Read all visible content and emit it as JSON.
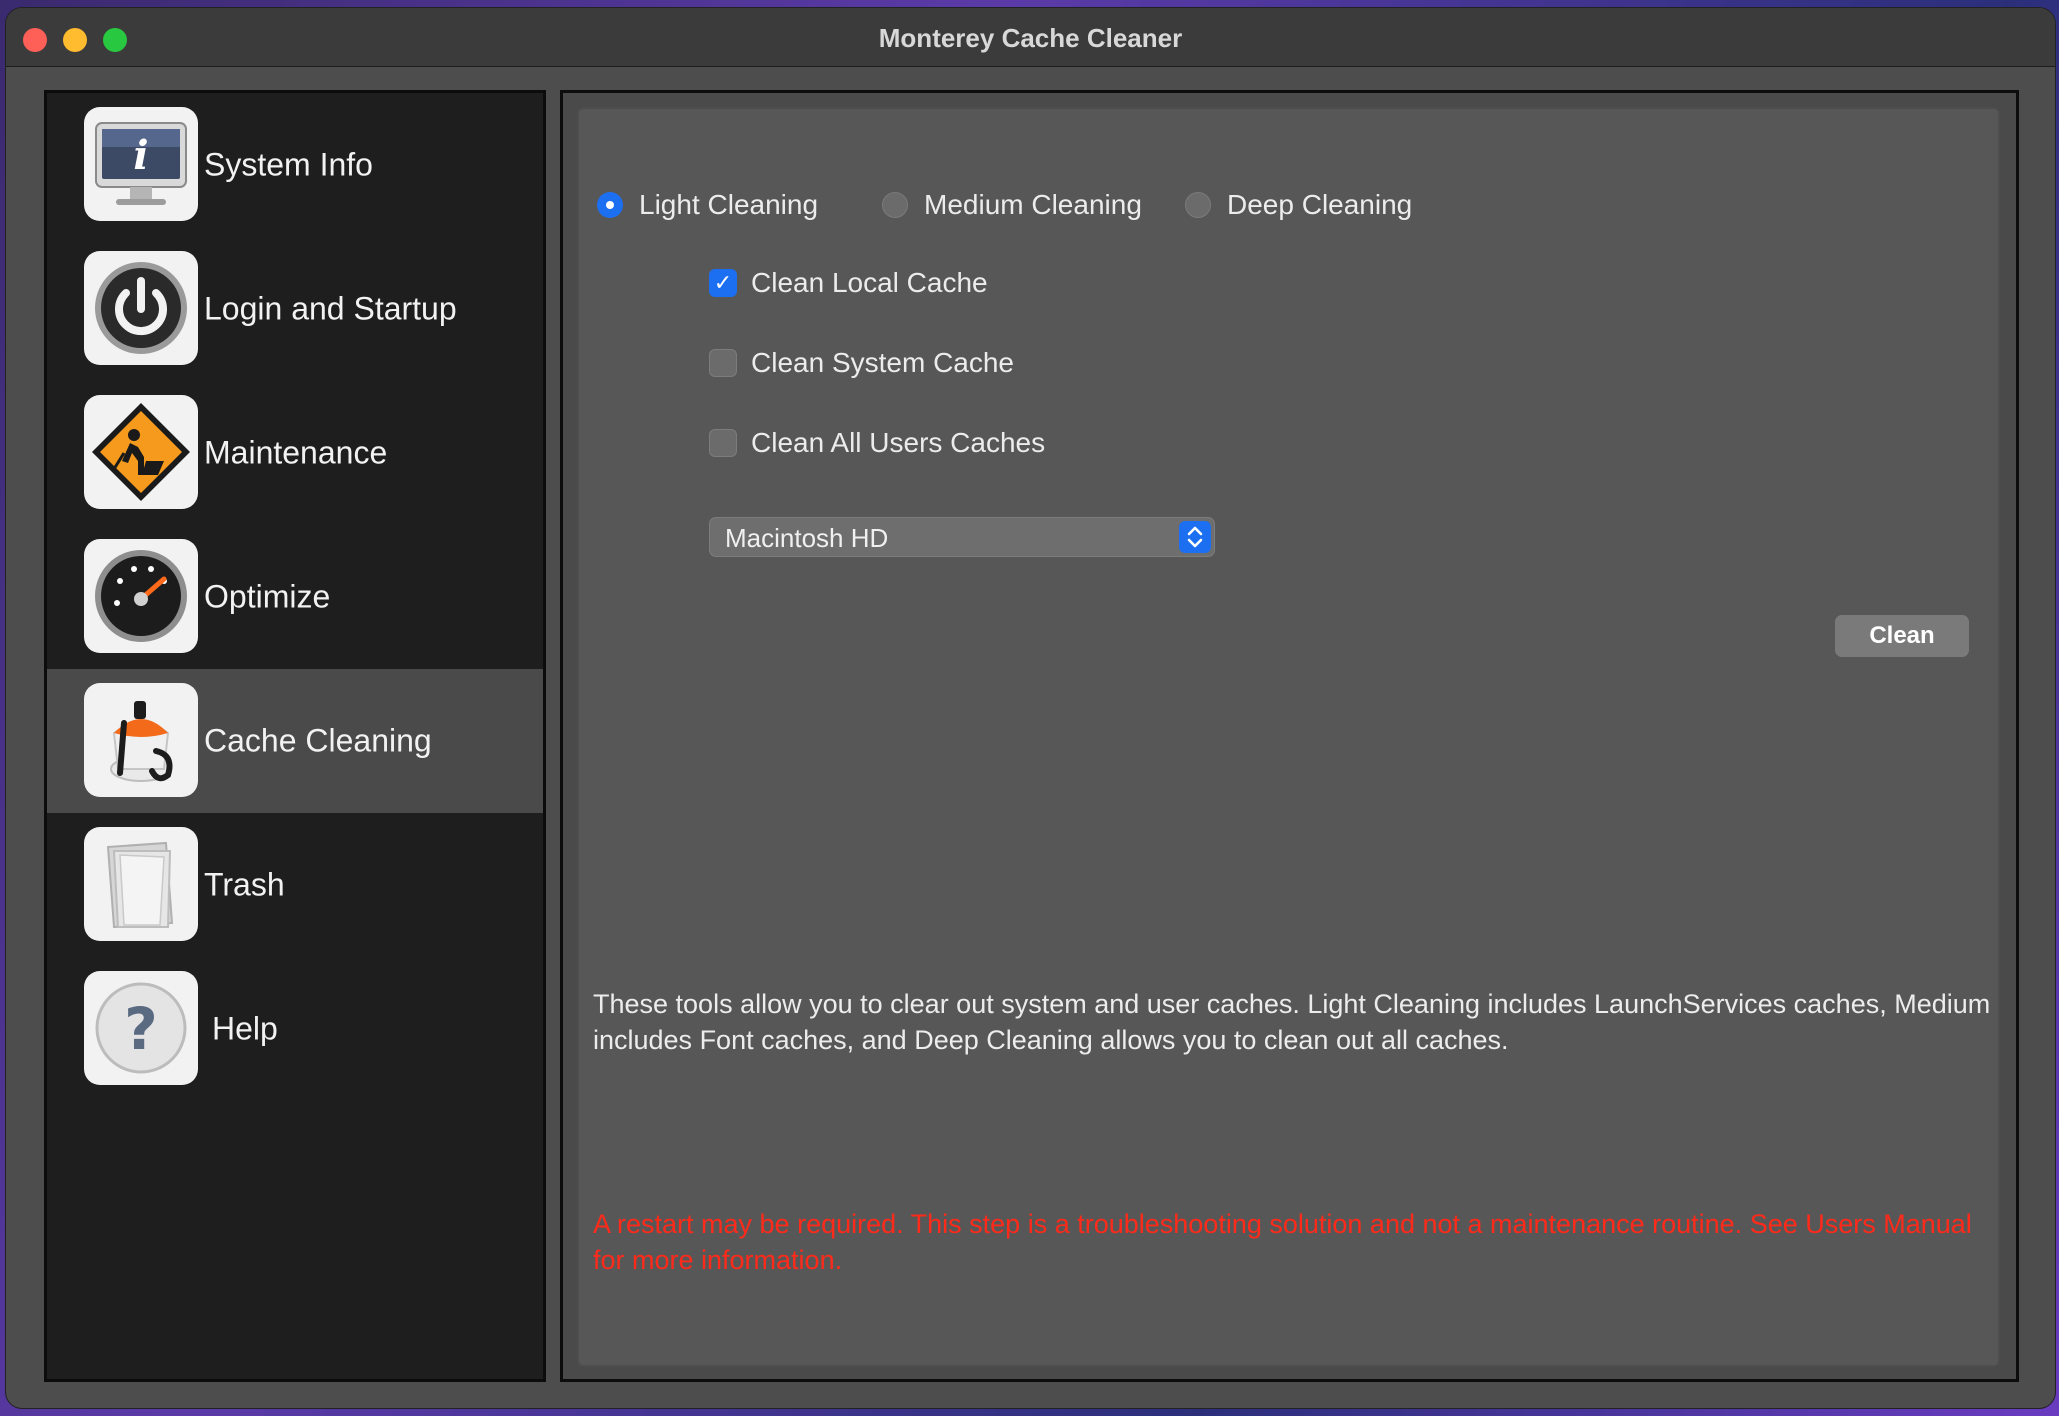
{
  "window": {
    "title": "Monterey Cache Cleaner"
  },
  "sidebar": {
    "items": [
      {
        "label": "System Info",
        "icon": "system-info-icon"
      },
      {
        "label": "Login and Startup",
        "icon": "power-icon"
      },
      {
        "label": "Maintenance",
        "icon": "maintenance-icon"
      },
      {
        "label": "Optimize",
        "icon": "gauge-icon"
      },
      {
        "label": "Cache Cleaning",
        "icon": "cache-cleaning-icon",
        "selected": true
      },
      {
        "label": "Trash",
        "icon": "trash-icon"
      },
      {
        "label": "Help",
        "icon": "help-icon"
      }
    ]
  },
  "main": {
    "modes": [
      {
        "label": "Light Cleaning",
        "selected": true
      },
      {
        "label": "Medium Cleaning",
        "selected": false
      },
      {
        "label": "Deep Cleaning",
        "selected": false
      }
    ],
    "options": [
      {
        "label": "Clean Local Cache",
        "checked": true
      },
      {
        "label": "Clean System Cache",
        "checked": false
      },
      {
        "label": "Clean All Users Caches",
        "checked": false
      }
    ],
    "volume": {
      "selected": "Macintosh HD"
    },
    "clean_label": "Clean",
    "description": "These tools allow you to clear out system and user caches.  Light Cleaning includes LaunchServices caches, Medium includes Font caches, and Deep Cleaning allows you to clean out all caches.",
    "warning": "A restart may be required.  This step is a troubleshooting solution and not a maintenance routine.  See Users Manual for more information."
  },
  "colors": {
    "accent": "#1d6ff2",
    "warning": "#ff2a1a",
    "close": "#fe5f57",
    "minimize": "#febc2e",
    "maximize": "#28c840"
  }
}
